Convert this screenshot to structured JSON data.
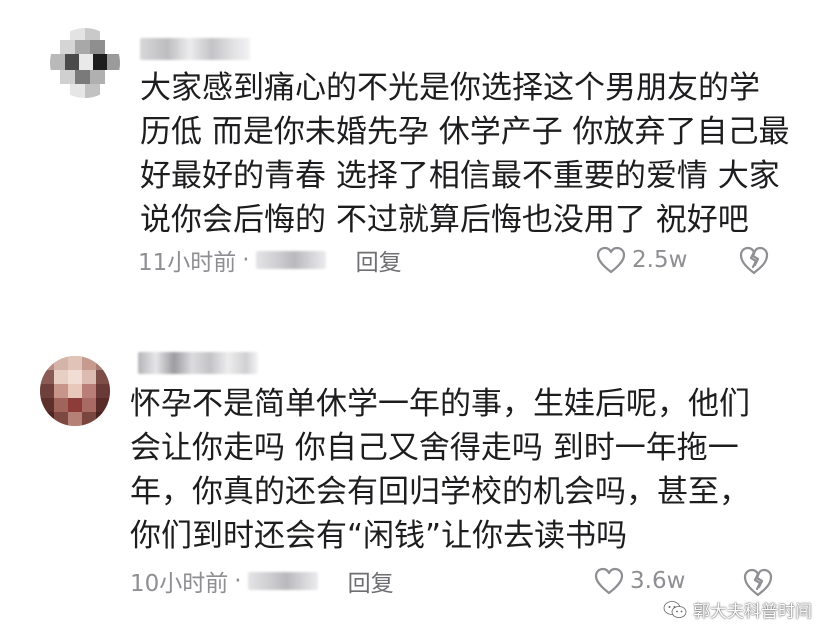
{
  "comments": [
    {
      "username": "",
      "text_lines": [
        "大家感到痛心的不光是你选择这个男朋友的学",
        "历低 而是你未婚先孕 休学产子 你放弃了自己最",
        "好最好的青春 选择了相信最不重要的爱情 大家",
        "说你会后悔的 不过就算后悔也没用了 祝好吧"
      ],
      "time": "11小时前",
      "separator": "·",
      "reply_label": "回复",
      "likes": "2.5w",
      "icons": {
        "like": "heart-outline-icon",
        "dislike": "broken-heart-icon",
        "avatar": "blurred-avatar"
      }
    },
    {
      "username": "",
      "text_lines": [
        "怀孕不是简单休学一年的事，生娃后呢，他们",
        "会让你走吗  你自己又舍得走吗  到时一年拖一",
        "年，你真的还会有回归学校的机会吗，甚至，",
        "你们到时还会有“闲钱”让你去读书吗"
      ],
      "time": "10小时前",
      "separator": "·",
      "reply_label": "回复",
      "likes": "3.6w",
      "icons": {
        "like": "heart-outline-icon",
        "dislike": "broken-heart-icon",
        "avatar": "blurred-avatar"
      }
    }
  ],
  "watermark": {
    "text": "郭大夫科普时间",
    "icon": "wechat-icon"
  },
  "colors": {
    "text": "#1d1d1f",
    "meta": "#8e8e93",
    "background": "#ffffff"
  }
}
